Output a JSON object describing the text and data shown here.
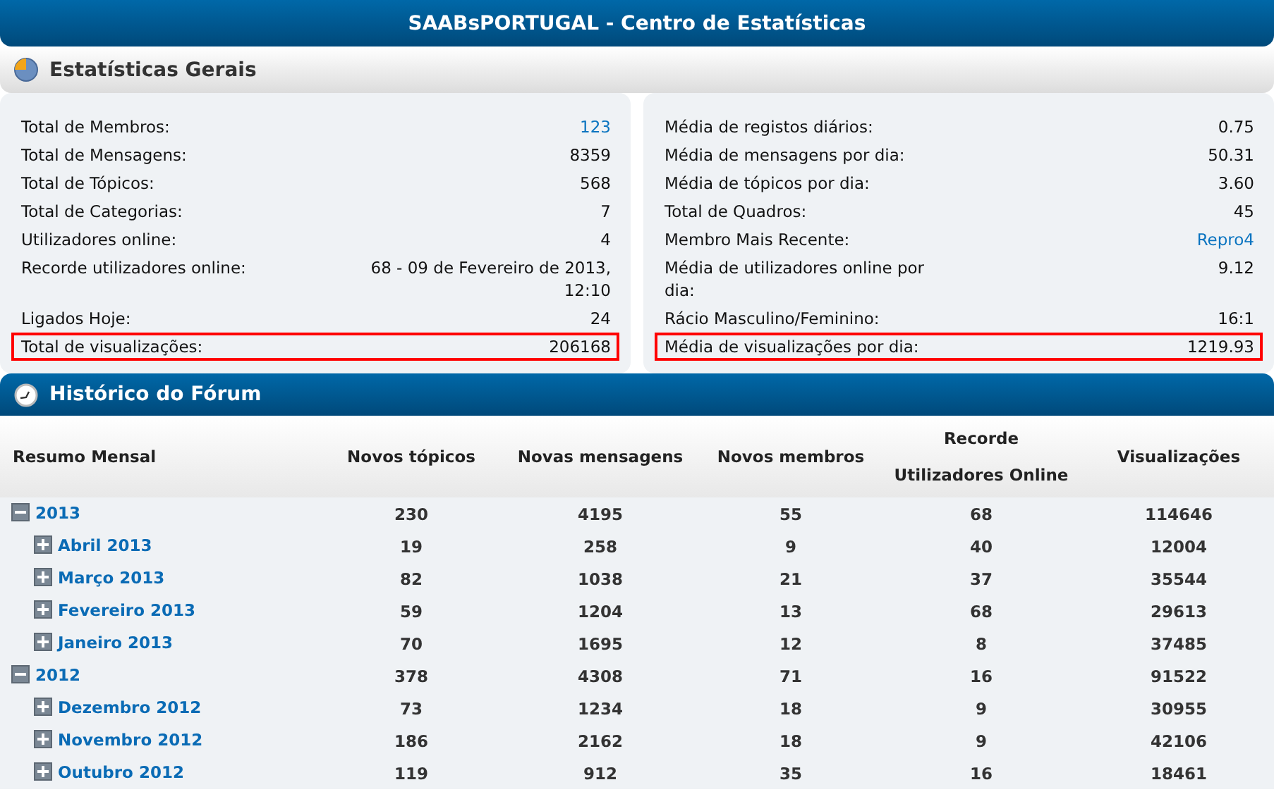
{
  "title": "SAABsPORTUGAL - Centro de Estatísticas",
  "general": {
    "heading": "Estatísticas Gerais",
    "panels": [
      {
        "rows": [
          {
            "label": "Total de Membros:",
            "value": "123",
            "link": true,
            "highlighted": false
          },
          {
            "label": "Total de Mensagens:",
            "value": "8359",
            "link": false,
            "highlighted": false
          },
          {
            "label": "Total de Tópicos:",
            "value": "568",
            "link": false,
            "highlighted": false
          },
          {
            "label": "Total de Categorias:",
            "value": "7",
            "link": false,
            "highlighted": false
          },
          {
            "label": "Utilizadores online:",
            "value": "4",
            "link": false,
            "highlighted": false
          },
          {
            "label": "Recorde utilizadores online:",
            "value": "68 - 09 de Fevereiro de 2013, 12:10",
            "link": false,
            "highlighted": false
          },
          {
            "label": "Ligados Hoje:",
            "value": "24",
            "link": false,
            "highlighted": false
          },
          {
            "label": "Total de visualizações:",
            "value": "206168",
            "link": false,
            "highlighted": true
          }
        ]
      },
      {
        "rows": [
          {
            "label": "Média de registos diários:",
            "value": "0.75",
            "link": false,
            "highlighted": false
          },
          {
            "label": "Média de mensagens por dia:",
            "value": "50.31",
            "link": false,
            "highlighted": false
          },
          {
            "label": "Média de tópicos por dia:",
            "value": "3.60",
            "link": false,
            "highlighted": false
          },
          {
            "label": "Total de Quadros:",
            "value": "45",
            "link": false,
            "highlighted": false
          },
          {
            "label": "Membro Mais Recente:",
            "value": "Repro4",
            "link": true,
            "highlighted": false
          },
          {
            "label": "Média de utilizadores online por dia:",
            "value": "9.12",
            "link": false,
            "highlighted": false
          },
          {
            "label": "Rácio Masculino/Feminino:",
            "value": "16:1",
            "link": false,
            "highlighted": false
          },
          {
            "label": "Média de visualizações por dia:",
            "value": "1219.93",
            "link": false,
            "highlighted": true
          }
        ]
      }
    ]
  },
  "history": {
    "heading": "Histórico do Fórum",
    "columns": [
      "Resumo Mensal",
      "Novos tópicos",
      "Novas mensagens",
      "Novos membros",
      "Recorde Utilizadores Online",
      "Visualizações"
    ],
    "rows": [
      {
        "expanded": true,
        "cells": [
          "2013",
          "230",
          "4195",
          "55",
          "68",
          "114646"
        ],
        "children": [
          {
            "expanded": false,
            "cells": [
              "Abril 2013",
              "19",
              "258",
              "9",
              "40",
              "12004"
            ]
          },
          {
            "expanded": false,
            "cells": [
              "Março 2013",
              "82",
              "1038",
              "21",
              "37",
              "35544"
            ]
          },
          {
            "expanded": false,
            "cells": [
              "Fevereiro 2013",
              "59",
              "1204",
              "13",
              "68",
              "29613"
            ]
          },
          {
            "expanded": false,
            "cells": [
              "Janeiro 2013",
              "70",
              "1695",
              "12",
              "8",
              "37485"
            ]
          }
        ]
      },
      {
        "expanded": true,
        "cells": [
          "2012",
          "378",
          "4308",
          "71",
          "16",
          "91522"
        ],
        "children": [
          {
            "expanded": false,
            "cells": [
              "Dezembro 2012",
              "73",
              "1234",
              "18",
              "9",
              "30955"
            ]
          },
          {
            "expanded": false,
            "cells": [
              "Novembro 2012",
              "186",
              "2162",
              "18",
              "9",
              "42106"
            ]
          },
          {
            "expanded": false,
            "cells": [
              "Outubro 2012",
              "119",
              "912",
              "35",
              "16",
              "18461"
            ]
          }
        ]
      }
    ]
  }
}
